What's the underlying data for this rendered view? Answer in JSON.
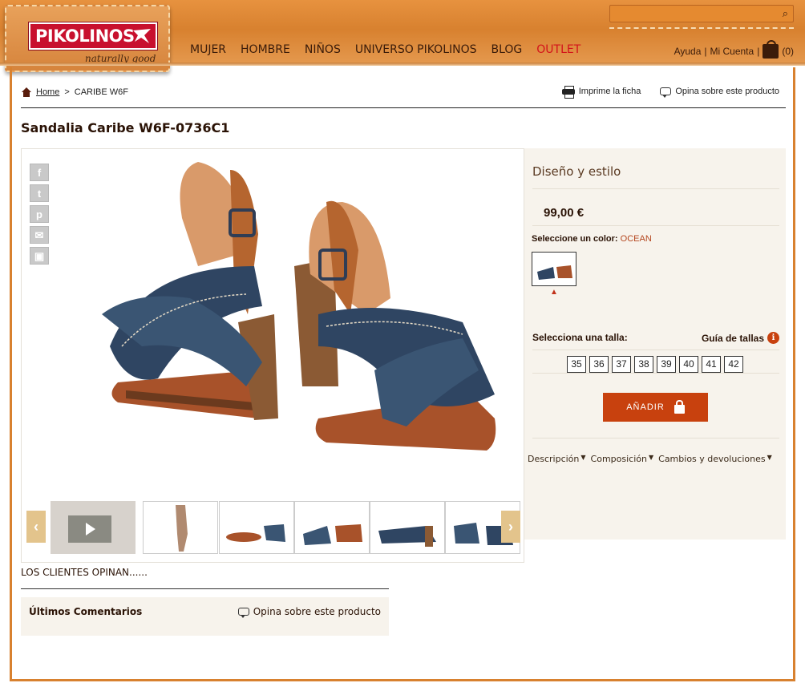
{
  "header": {
    "logo": "PIKOLINOS",
    "tagline": "naturally good",
    "nav": [
      "MUJER",
      "HOMBRE",
      "NIÑOS",
      "UNIVERSO PIKOLINOS",
      "BLOG",
      "OUTLET"
    ],
    "help": "Ayuda",
    "account": "Mi Cuenta",
    "sep1": "|",
    "sep2": "|",
    "cart_count": "(0)"
  },
  "breadcrumb": {
    "home": "Home",
    "sep": ">",
    "current": "CARIBE W6F"
  },
  "tools": {
    "print": "Imprime la ficha",
    "review": "Opina sobre este producto"
  },
  "product": {
    "title": "Sandalia Caribe W6F-0736C1",
    "section": "Diseño y estilo",
    "price": "99,00 €",
    "color_label": "Seleccione un color:",
    "color_value": "OCEAN",
    "size_label": "Selecciona una talla:",
    "size_guide": "Guía de tallas",
    "sizes": [
      "35",
      "36",
      "37",
      "38",
      "39",
      "40",
      "41",
      "42"
    ],
    "add_button": "AÑADIR",
    "tabs": [
      "Descripción",
      "Composición",
      "Cambios y devoluciones"
    ]
  },
  "share": {
    "facebook": "f",
    "twitter": "t",
    "pinterest": "p",
    "email": "✉",
    "gift": "▣"
  },
  "gallery": {
    "prev": "‹",
    "next": "›"
  },
  "reviews": {
    "heading": "LOS CLIENTES OPINAN......",
    "latest": "Últimos Comentarios",
    "write": "Opina sobre este producto"
  },
  "colors": {
    "brand_red": "#c8102e",
    "accent": "#c8410e",
    "header_orange": "#d8812f"
  }
}
